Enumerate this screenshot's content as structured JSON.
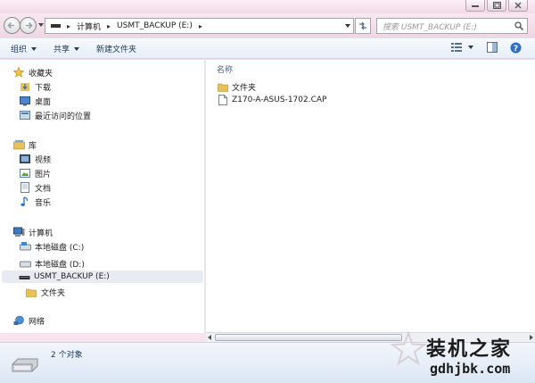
{
  "nav": {
    "crumbs": [
      "计算机",
      "USMT_BACKUP (E:)"
    ],
    "search_placeholder": "搜索 USMT_BACKUP (E:)"
  },
  "toolbar": {
    "organize": "组织",
    "share": "共享",
    "new_folder": "新建文件夹"
  },
  "sidebar": {
    "favorites": "收藏夹",
    "downloads": "下载",
    "desktop": "桌面",
    "recent": "最近访问的位置",
    "libraries": "库",
    "videos": "视频",
    "pictures": "图片",
    "documents": "文档",
    "music": "音乐",
    "computer": "计算机",
    "drive_c": "本地磁盘 (C:)",
    "drive_d": "本地磁盘 (D:)",
    "drive_e": "USMT_BACKUP (E:)",
    "folder": "文件夹",
    "network": "网络"
  },
  "content": {
    "column_name": "名称",
    "items": [
      {
        "name": "文件夹",
        "icon": "folder-icon"
      },
      {
        "name": "Z170-A-ASUS-1702.CAP",
        "icon": "file-icon"
      }
    ]
  },
  "status": {
    "count": "2 个对象"
  },
  "watermark": {
    "title": "装机之家",
    "url": "gdhjbk.com"
  },
  "colors": {
    "folder": "#e8c15a",
    "toolbar_text": "#1e395b",
    "selection": "#e8ecf2"
  }
}
